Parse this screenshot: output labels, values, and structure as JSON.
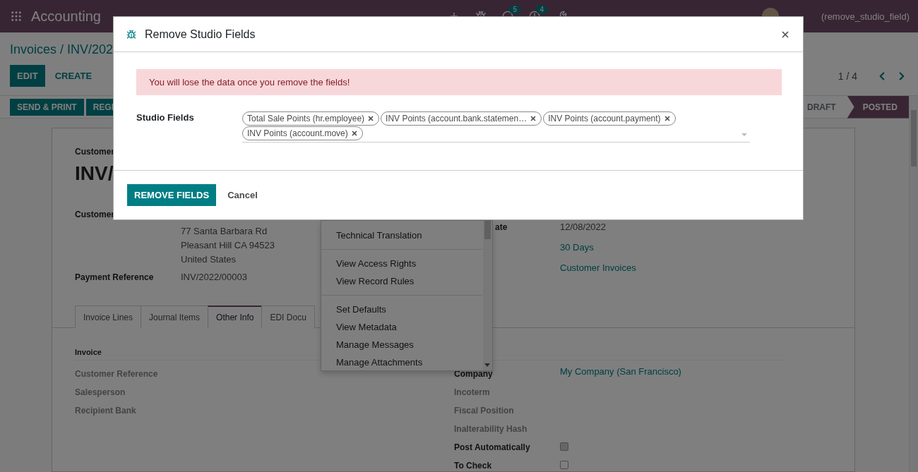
{
  "navbar": {
    "app": "Accounting",
    "chat_count": "5",
    "activity_count": "4",
    "user": "(remove_studio_field)"
  },
  "breadcrumb": "Invoices / INV/202",
  "actions": [
    {
      "label": "EDIT",
      "kind": "primary"
    },
    {
      "label": "CREATE",
      "kind": "secondary"
    }
  ],
  "pager": "1 / 4",
  "status_actions": [
    "SEND & PRINT",
    "REGI"
  ],
  "stages": [
    {
      "label": "DRAFT",
      "selected": false
    },
    {
      "label": "POSTED",
      "selected": true
    }
  ],
  "sheet": {
    "type_label": "Customer",
    "number": "INV/",
    "partner_label": "Customer",
    "address": [
      "77 Santa Barbara Rd",
      "Pleasant Hill CA 94523",
      "United States"
    ],
    "payment_reference": {
      "label": "Payment Reference",
      "value": "INV/2022/00003"
    },
    "right_fields": [
      {
        "label": "ate",
        "value": "12/08/2022",
        "kind": "plain"
      },
      {
        "value": "30 Days",
        "kind": "link"
      },
      {
        "value": "Customer Invoices",
        "kind": "link"
      }
    ]
  },
  "tabs": [
    {
      "label": "Invoice Lines",
      "selected": false
    },
    {
      "label": "Journal Items",
      "selected": false
    },
    {
      "label": "Other Info",
      "selected": true
    },
    {
      "label": "EDI Docu",
      "selected": false
    }
  ],
  "other_info": {
    "left_group": "Invoice",
    "left_fields": [
      {
        "label": "Customer Reference",
        "empty": true
      },
      {
        "label": "Salesperson",
        "empty": true
      },
      {
        "label": "Recipient Bank",
        "empty": true
      }
    ],
    "right_fields": [
      {
        "label": "Company",
        "empty": false,
        "kind": "link",
        "value": "My Company (San Francisco)"
      },
      {
        "label": "Incoterm",
        "empty": true,
        "kind": "text"
      },
      {
        "label": "Fiscal Position",
        "empty": true,
        "kind": "text"
      },
      {
        "label": "Inalterability Hash",
        "empty": true,
        "kind": "text"
      },
      {
        "label": "Post Automatically",
        "empty": false,
        "kind": "checkbox",
        "checked": false,
        "disabled": true
      },
      {
        "label": "To Check",
        "empty": false,
        "kind": "checkbox",
        "checked": false,
        "disabled": false
      }
    ]
  },
  "debug_menu": [
    [
      "Technical Translation"
    ],
    [
      "View Access Rights",
      "View Record Rules"
    ],
    [
      "Set Defaults",
      "View Metadata",
      "Manage Messages",
      "Manage Attachments"
    ]
  ],
  "dialog": {
    "title": "Remove Studio Fields",
    "alert": "You will lose the data once you remove the fields!",
    "field_label": "Studio Fields",
    "tags": [
      "Total Sale Points (hr.employee)",
      "INV Points (account.bank.statemen…",
      "INV Points (account.payment)",
      "INV Points (account.move)"
    ],
    "primary_button": "REMOVE FIELDS",
    "secondary_button": "Cancel"
  }
}
